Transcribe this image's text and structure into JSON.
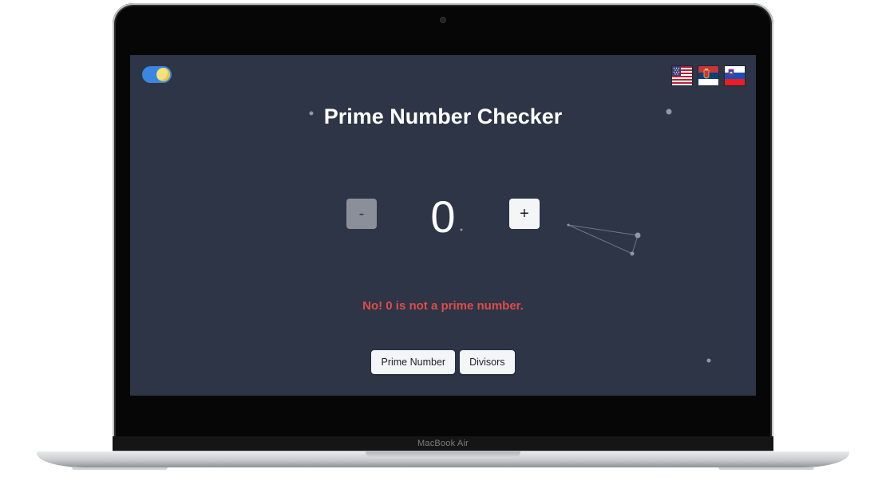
{
  "laptop": {
    "model_label": "MacBook Air"
  },
  "theme_toggle": {
    "state": "on",
    "icon": "sun-icon"
  },
  "languages": [
    {
      "name": "english",
      "icon": "us-flag-icon"
    },
    {
      "name": "serbian",
      "icon": "serbia-flag-icon"
    },
    {
      "name": "slovenian",
      "icon": "slovenia-flag-icon"
    }
  ],
  "title": "Prime Number Checker",
  "counter": {
    "minus_label": "-",
    "value": "0",
    "plus_label": "+"
  },
  "result": {
    "message": "No! 0 is not a prime number.",
    "color": "#e04b4b"
  },
  "actions": {
    "prime_label": "Prime Number",
    "divisors_label": "Divisors"
  },
  "colors": {
    "screen_bg": "#2d3546",
    "toggle_accent": "#3b86e0"
  }
}
